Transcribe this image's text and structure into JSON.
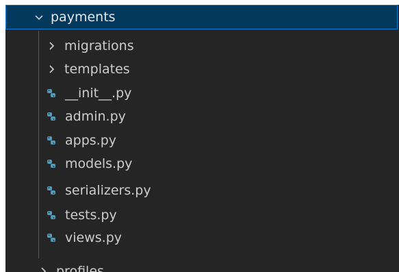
{
  "explorer": {
    "folder": {
      "name": "payments",
      "expanded": true,
      "chevron_icon": "chevron-down-icon"
    },
    "children": [
      {
        "name": "migrations",
        "type": "folder",
        "icon": "chevron-right-icon"
      },
      {
        "name": "templates",
        "type": "folder",
        "icon": "chevron-right-icon"
      },
      {
        "name": "__init__.py",
        "type": "file",
        "icon": "python-file-icon"
      },
      {
        "name": "admin.py",
        "type": "file",
        "icon": "python-file-icon"
      },
      {
        "name": "apps.py",
        "type": "file",
        "icon": "python-file-icon"
      },
      {
        "name": "models.py",
        "type": "file",
        "icon": "python-file-icon"
      },
      {
        "name": "serializers.py",
        "type": "file",
        "icon": "python-file-icon"
      },
      {
        "name": "tests.py",
        "type": "file",
        "icon": "python-file-icon"
      },
      {
        "name": "views.py",
        "type": "file",
        "icon": "python-file-icon"
      }
    ],
    "next_folder": {
      "name": "profiles",
      "expanded": false,
      "chevron_icon": "chevron-right-icon"
    }
  },
  "colors": {
    "background": "#252526",
    "selected_row": "#04395e",
    "focus_border": "#007fd4",
    "text": "#cccccc",
    "python_icon": "#519aba"
  }
}
